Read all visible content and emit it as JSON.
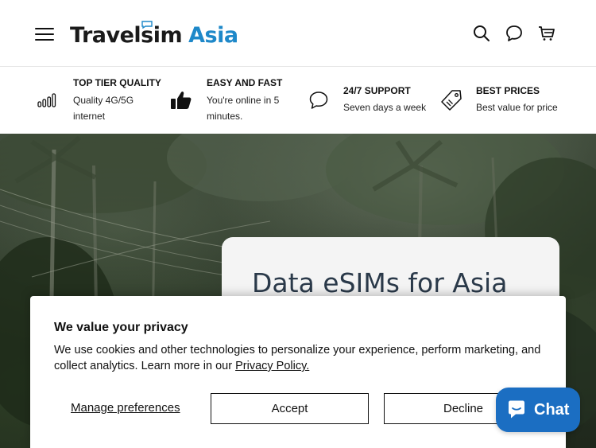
{
  "header": {
    "logo_part1": "Travelsim",
    "logo_part2": "Asia",
    "icons": [
      "menu-icon",
      "search-icon",
      "chat-icon",
      "cart-icon"
    ]
  },
  "features": [
    {
      "title": "TOP TIER QUALITY",
      "desc": "Quality 4G/5G internet",
      "icon": "signal-bars-icon"
    },
    {
      "title": "EASY AND FAST",
      "desc": "You're online in 5 minutes.",
      "icon": "thumbs-up-icon"
    },
    {
      "title": "24/7 SUPPORT",
      "desc": "Seven days a week",
      "icon": "speech-bubble-icon"
    },
    {
      "title": "BEST PRICES",
      "desc": "Best value for price",
      "icon": "price-tag-icon"
    }
  ],
  "hero": {
    "title": "Data eSIMs for Asia"
  },
  "cookie": {
    "title": "We value your privacy",
    "text": "We use cookies and other technologies to personalize your experience, perform marketing, and collect analytics. Learn more in our",
    "link": "Privacy Policy.",
    "manage": "Manage preferences",
    "accept": "Accept",
    "decline": "Decline"
  },
  "chat": {
    "label": "Chat"
  },
  "colors": {
    "brand_blue": "#1e88c9",
    "chat_blue": "#1b6ec2"
  }
}
